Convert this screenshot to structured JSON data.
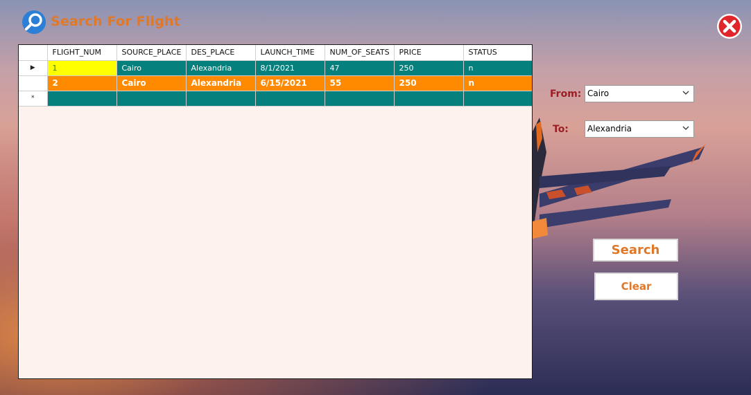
{
  "window": {
    "title": "Search For Flight"
  },
  "grid": {
    "columns": [
      "FLIGHT_NUM",
      "SOURCE_PLACE",
      "DES_PLACE",
      "LAUNCH_TIME",
      "NUM_OF_SEATS",
      "PRICE",
      "STATUS"
    ],
    "rows": [
      {
        "indicator": "▶",
        "cells": [
          "1",
          "Cairo",
          "Alexandria",
          "8/1/2021",
          "47",
          "250",
          "n"
        ]
      },
      {
        "indicator": "",
        "cells": [
          "2",
          "Cairo",
          "Alexandria",
          "6/15/2021",
          "55",
          "250",
          "n"
        ]
      }
    ],
    "new_row_indicator": "*"
  },
  "search_form": {
    "from_label": "From:",
    "from_value": "Cairo",
    "to_label": "To:",
    "to_value": "Alexandria",
    "search_label": "Search",
    "clear_label": "Clear"
  },
  "colors": {
    "accent": "#e0782a",
    "label": "#9c1e24",
    "row_teal": "#05807d",
    "row_orange": "#ff8a00",
    "cell_selected": "#ffff00",
    "close_red": "#e1262b"
  },
  "icons": {
    "title": "magnifier-icon",
    "close": "close-icon",
    "dropdown": "chevron-down-icon"
  }
}
